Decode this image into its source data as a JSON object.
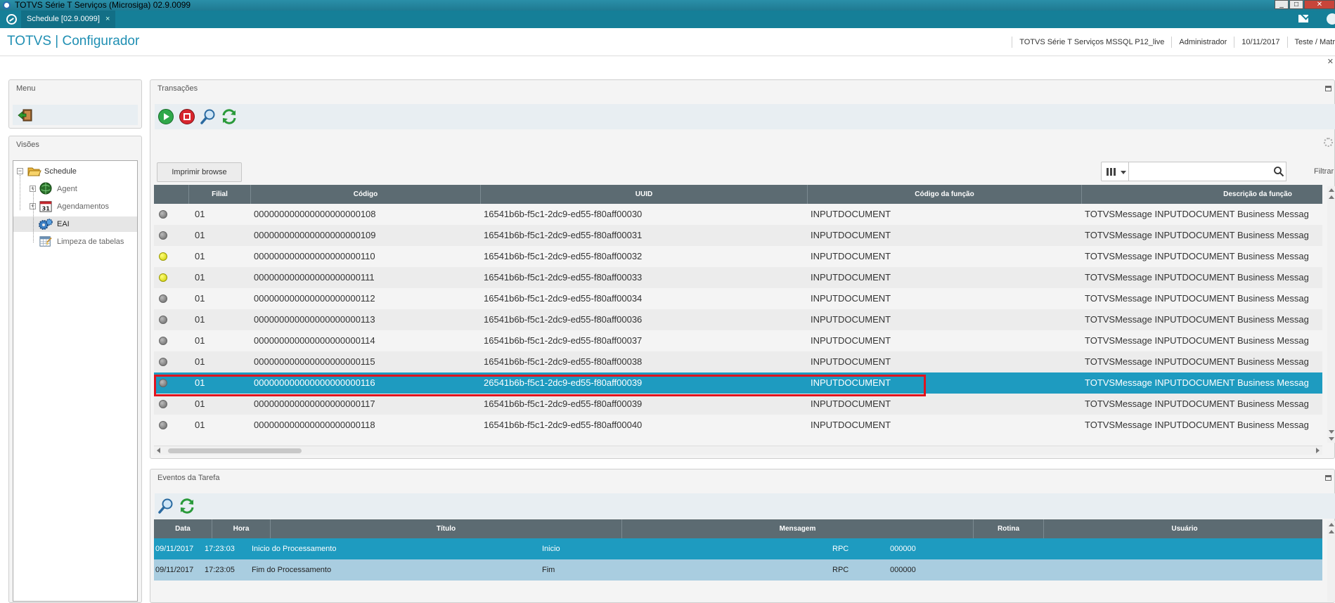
{
  "window": {
    "title": "TOTVS Série T Serviços (Microsiga) 02.9.0099"
  },
  "tabbar": {
    "tab_label": "Schedule [02.9.0099]",
    "tab_close": "×"
  },
  "header": {
    "brand": "TOTVS | Configurador",
    "environment": "TOTVS Série T Serviços MSSQL P12_live",
    "user": "Administrador",
    "date": "10/11/2017",
    "branch": "Teste / Matr"
  },
  "menu_panel": {
    "title": "Menu"
  },
  "visoes_panel": {
    "title": "Visões",
    "tree": [
      {
        "label": "Schedule",
        "icon": "folder-open-icon"
      },
      {
        "label": "Agent",
        "icon": "agent-globe-icon"
      },
      {
        "label": "Agendamentos",
        "icon": "calendar-icon"
      },
      {
        "label": "EAI",
        "icon": "gears-icon"
      },
      {
        "label": "Limpeza de tabelas",
        "icon": "table-clean-icon"
      }
    ],
    "calendar_day": "31"
  },
  "transacoes": {
    "title": "Transações",
    "toolbar": [
      "play-icon",
      "stop-icon",
      "search-icon",
      "refresh-icon"
    ],
    "print_button": "Imprimir browse",
    "search_placeholder": "",
    "filter_label": "Filtrar",
    "columns": [
      "Filial",
      "Código",
      "UUID",
      "Código da função",
      "Descrição da função"
    ],
    "rows": [
      {
        "status": "gray",
        "filial": "01",
        "codigo": "000000000000000000000108",
        "uuid": "16541b6b-f5c1-2dc9-ed55-f80aff00030",
        "funcao": "INPUTDOCUMENT",
        "descricao": "TOTVSMessage INPUTDOCUMENT Business Messag"
      },
      {
        "status": "gray",
        "filial": "01",
        "codigo": "000000000000000000000109",
        "uuid": "16541b6b-f5c1-2dc9-ed55-f80aff00031",
        "funcao": "INPUTDOCUMENT",
        "descricao": "TOTVSMessage INPUTDOCUMENT Business Messag"
      },
      {
        "status": "yellow",
        "filial": "01",
        "codigo": "000000000000000000000110",
        "uuid": "16541b6b-f5c1-2dc9-ed55-f80aff00032",
        "funcao": "INPUTDOCUMENT",
        "descricao": "TOTVSMessage INPUTDOCUMENT Business Messag"
      },
      {
        "status": "yellow",
        "filial": "01",
        "codigo": "000000000000000000000111",
        "uuid": "16541b6b-f5c1-2dc9-ed55-f80aff00033",
        "funcao": "INPUTDOCUMENT",
        "descricao": "TOTVSMessage INPUTDOCUMENT Business Messag"
      },
      {
        "status": "gray",
        "filial": "01",
        "codigo": "000000000000000000000112",
        "uuid": "16541b6b-f5c1-2dc9-ed55-f80aff00034",
        "funcao": "INPUTDOCUMENT",
        "descricao": "TOTVSMessage INPUTDOCUMENT Business Messag"
      },
      {
        "status": "gray",
        "filial": "01",
        "codigo": "000000000000000000000113",
        "uuid": "16541b6b-f5c1-2dc9-ed55-f80aff00036",
        "funcao": "INPUTDOCUMENT",
        "descricao": "TOTVSMessage INPUTDOCUMENT Business Messag"
      },
      {
        "status": "gray",
        "filial": "01",
        "codigo": "000000000000000000000114",
        "uuid": "16541b6b-f5c1-2dc9-ed55-f80aff00037",
        "funcao": "INPUTDOCUMENT",
        "descricao": "TOTVSMessage INPUTDOCUMENT Business Messag"
      },
      {
        "status": "gray",
        "filial": "01",
        "codigo": "000000000000000000000115",
        "uuid": "16541b6b-f5c1-2dc9-ed55-f80aff00038",
        "funcao": "INPUTDOCUMENT",
        "descricao": "TOTVSMessage INPUTDOCUMENT Business Messag"
      },
      {
        "status": "gray",
        "filial": "01",
        "codigo": "000000000000000000000116",
        "uuid": "26541b6b-f5c1-2dc9-ed55-f80aff00039",
        "funcao": "INPUTDOCUMENT",
        "descricao": "TOTVSMessage INPUTDOCUMENT Business Messag",
        "selected": true
      },
      {
        "status": "gray",
        "filial": "01",
        "codigo": "000000000000000000000117",
        "uuid": "16541b6b-f5c1-2dc9-ed55-f80aff00039",
        "funcao": "INPUTDOCUMENT",
        "descricao": "TOTVSMessage INPUTDOCUMENT Business Messag"
      },
      {
        "status": "gray",
        "filial": "01",
        "codigo": "000000000000000000000118",
        "uuid": "16541b6b-f5c1-2dc9-ed55-f80aff00040",
        "funcao": "INPUTDOCUMENT",
        "descricao": "TOTVSMessage INPUTDOCUMENT Business Messag"
      }
    ]
  },
  "eventos": {
    "title": "Eventos da Tarefa",
    "toolbar": [
      "search-icon",
      "refresh-icon"
    ],
    "columns": [
      "Data",
      "Hora",
      "Título",
      "Mensagem",
      "Rotina",
      "Usuário"
    ],
    "rows": [
      {
        "data": "09/11/2017",
        "hora": "17:23:03",
        "titulo": "Inicio do Processamento",
        "mensagem": "Inicio",
        "rotina": "RPC",
        "usuario": "000000"
      },
      {
        "data": "09/11/2017",
        "hora": "17:23:05",
        "titulo": "Fim do Processamento",
        "mensagem": "Fim",
        "rotina": "RPC",
        "usuario": "000000"
      }
    ]
  },
  "colors": {
    "brand": "#1f8fb3",
    "tabbar": "#157f98",
    "grid_header": "#5c6b72",
    "selected_row": "#1e9bc0",
    "highlight_border": "#e0141e"
  }
}
